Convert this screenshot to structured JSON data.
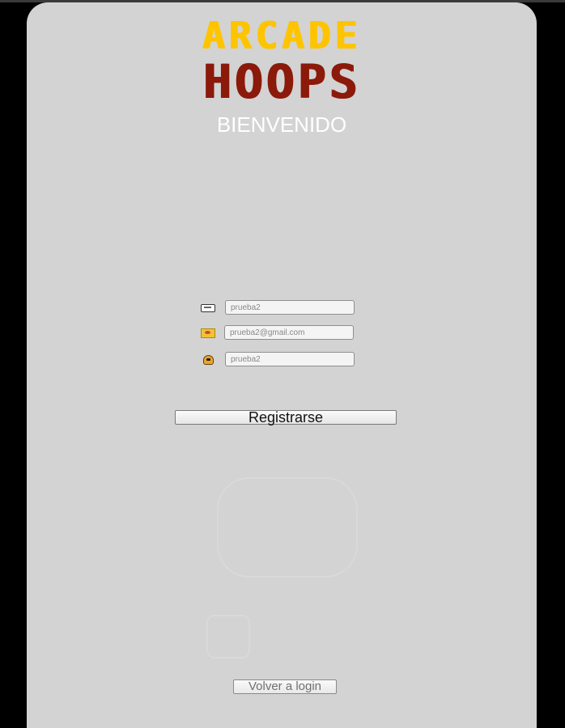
{
  "logo": {
    "line1": "ARCADE",
    "line2": "HOOPS",
    "line1_color": "#ffc400",
    "line2_color": "#8b1a0a"
  },
  "welcome": "BIENVENIDO",
  "form": {
    "fields": [
      {
        "icon": "user-card-icon",
        "value": "prueba2",
        "type": "text"
      },
      {
        "icon": "mail-icon",
        "value": "prueba2@gmail.com",
        "type": "email"
      },
      {
        "icon": "lock-icon",
        "value": "prueba2",
        "type": "text"
      }
    ],
    "register_label": "Registrarse"
  },
  "back_label": "Volver a login",
  "colors": {
    "panel": "#d3d3d3",
    "frame": "#000000",
    "welcome_text": "#ffffff"
  }
}
